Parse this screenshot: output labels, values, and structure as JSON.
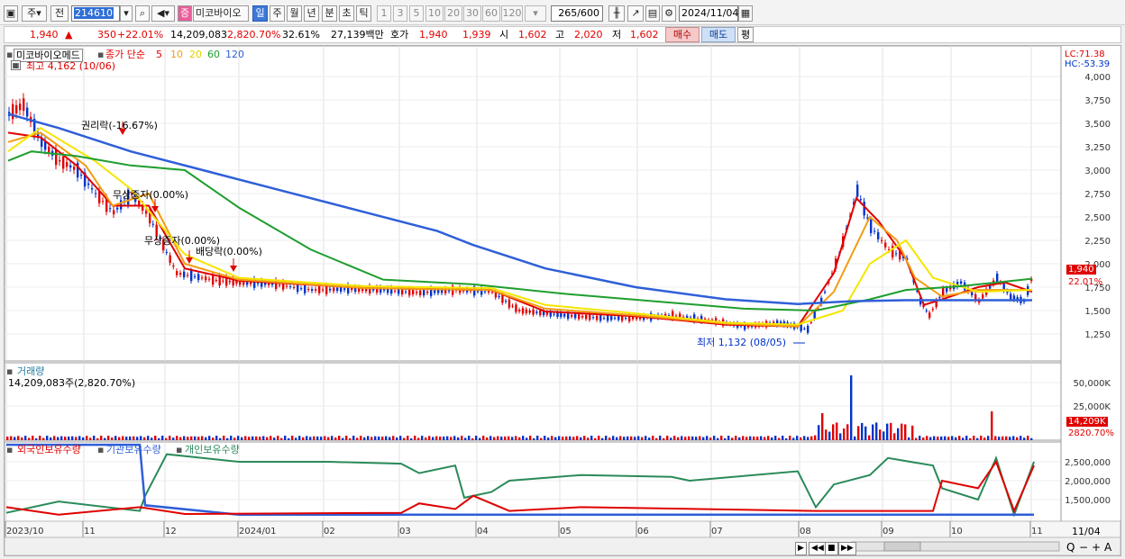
{
  "toolbar": {
    "type_label": "주",
    "prev_label": "전",
    "stock_code": "214610",
    "stock_name_badge": "증",
    "stock_name": "미코바이오",
    "periods": [
      "일",
      "주",
      "월",
      "년",
      "분",
      "초",
      "틱"
    ],
    "intervals": [
      "1",
      "3",
      "5",
      "10",
      "20",
      "30",
      "60",
      "120"
    ],
    "count": "265",
    "count_max": "/600",
    "date": "2024/11/04"
  },
  "quote": {
    "price": "1,940",
    "change": "350",
    "change_pct": "+22.01%",
    "volume": "14,209,083",
    "volume_pct": "2,820.70%",
    "turnover_pct": "32.61%",
    "amount": "27,139백만",
    "hoga_label": "호가",
    "ask": "1,940",
    "bid": "1,939",
    "open_label": "시",
    "open": "1,602",
    "high_label": "고",
    "high": "2,020",
    "low_label": "저",
    "low": "1,602",
    "buy_button": "매수",
    "sell_button": "매도",
    "eval_button": "평"
  },
  "price_panel": {
    "title": "미코바이오메드",
    "ma_label": "종가 단순",
    "ma_periods": [
      "5",
      "10",
      "20",
      "60",
      "120"
    ],
    "ma_colors": [
      "#e00000",
      "#f39c12",
      "#f5e600",
      "#1e9e2e",
      "#2f5fd8"
    ],
    "high_note": "최고 4,162 (10/06)",
    "low_note": "최저 1,132 (08/05)",
    "lc": "LC:71.38",
    "hc": "HC:-53.39",
    "current_price_tag": "1,940",
    "current_pct_tag": "22.01%",
    "y_ticks": [
      "4,000",
      "3,750",
      "3,500",
      "3,250",
      "3,000",
      "2,750",
      "2,500",
      "2,250",
      "2,000",
      "1,750",
      "1,500",
      "1,250"
    ],
    "events": [
      "권리락(-16.67%)",
      "무상증자(0.00%)",
      "무상증자(0.00%)",
      "배당락(0.00%)"
    ]
  },
  "volume_panel": {
    "title": "거래량",
    "value": "14,209,083주(2,820.70%)",
    "y_ticks": [
      "50,000K",
      "25,000K"
    ],
    "tag_value": "14,209K",
    "tag_pct": "2820.70%"
  },
  "holdings_panel": {
    "series": [
      "외국인보유수량",
      "기관보유수량",
      "개인보유수량"
    ],
    "y_ticks": [
      "2,500,000",
      "2,000,000",
      "1,500,000"
    ]
  },
  "x_axis": {
    "labels": [
      "2023/10",
      "11",
      "12",
      "2024/01",
      "02",
      "03",
      "04",
      "05",
      "06",
      "07",
      "08",
      "09",
      "10",
      "11"
    ],
    "end_label": "11/04"
  }
}
